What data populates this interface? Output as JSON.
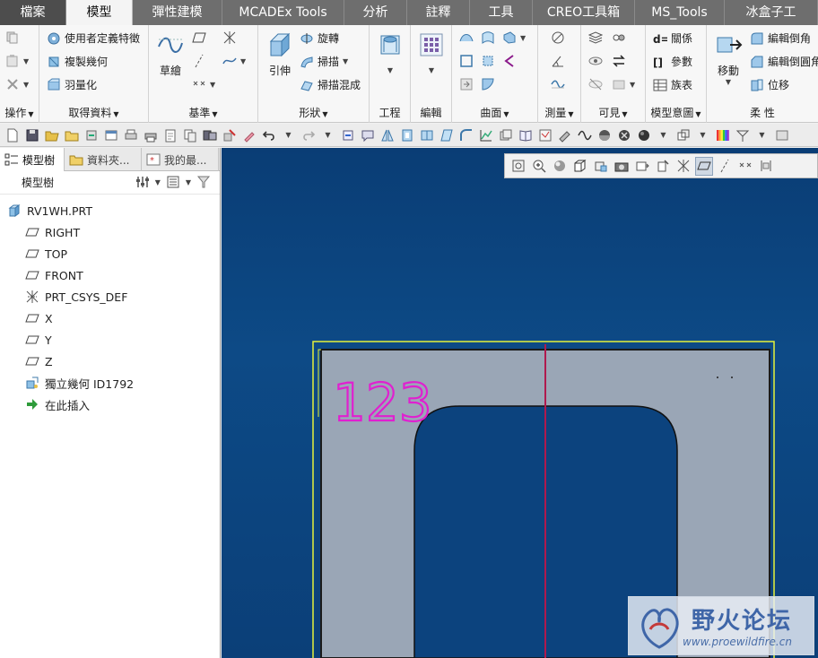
{
  "tabs": [
    {
      "label": "檔案"
    },
    {
      "label": "模型"
    },
    {
      "label": "彈性建模"
    },
    {
      "label": "MCADEx Tools"
    },
    {
      "label": "分析"
    },
    {
      "label": "註釋"
    },
    {
      "label": "工具"
    },
    {
      "label": "CREO工具箱"
    },
    {
      "label": "MS_Tools"
    },
    {
      "label": "冰盒子工"
    }
  ],
  "ribbon": {
    "groups": {
      "operations": "操作",
      "get_data": "取得資料",
      "datum": "基準",
      "shapes": "形狀",
      "engineering": "工程",
      "editing": "編輯",
      "surfaces": "曲面",
      "measure": "測量",
      "visibility": "可見",
      "model_intent": "模型意圖",
      "flexible": "柔 性"
    },
    "get_data_items": {
      "user_feature": "使用者定義特徵",
      "copy_geometry": "複製幾何",
      "shrinkwrap": "羽量化"
    },
    "sketch_label": "草繪",
    "extrude_label": "引伸",
    "shape_items": {
      "revolve": "旋轉",
      "sweep": "掃描",
      "swept_blend": "掃描混成"
    },
    "intent_items": {
      "relations": "關係",
      "parameters": "參數",
      "family_table": "族表"
    },
    "flex_items": {
      "move": "移動",
      "edit_round": "編輯倒角",
      "edit_chamfer": "編輯倒圓角",
      "offset": "位移"
    }
  },
  "left_panel": {
    "tabs": {
      "model_tree": "模型樹",
      "folder_browser": "資料夾...",
      "favorites": "我的最..."
    },
    "tree_header": "模型樹",
    "tree": [
      {
        "label": "RV1WH.PRT",
        "icon": "part-icon",
        "level": 0
      },
      {
        "label": "RIGHT",
        "icon": "datum-plane-icon",
        "level": 1
      },
      {
        "label": "TOP",
        "icon": "datum-plane-icon",
        "level": 1
      },
      {
        "label": "FRONT",
        "icon": "datum-plane-icon",
        "level": 1
      },
      {
        "label": "PRT_CSYS_DEF",
        "icon": "csys-icon",
        "level": 1
      },
      {
        "label": "X",
        "icon": "datum-plane-icon",
        "level": 1
      },
      {
        "label": "Y",
        "icon": "datum-plane-icon",
        "level": 1
      },
      {
        "label": "Z",
        "icon": "datum-plane-icon",
        "level": 1
      },
      {
        "label": "獨立幾何 ID1792",
        "icon": "independent-geometry-icon",
        "level": 1
      },
      {
        "label": "在此插入",
        "icon": "insert-here-icon",
        "level": 1
      }
    ]
  },
  "viewport": {
    "model_text": "123"
  },
  "watermark": {
    "title": "野火论坛",
    "url": "www.proewildfire.cn"
  },
  "colors": {
    "tabbar": "#6e6e6e",
    "viewport_bg": "#0d4a86",
    "part_fill": "#9aa6b6",
    "highlight_frame": "#e6f23a",
    "datum_line": "#b0194d",
    "model_text": "#e020d0"
  }
}
